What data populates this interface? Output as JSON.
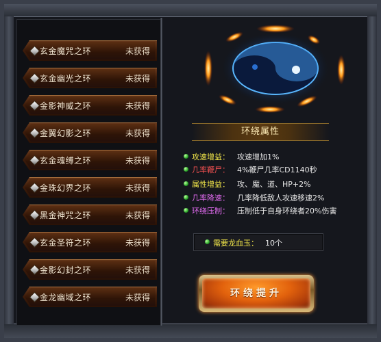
{
  "rings": [
    {
      "name": "玄金魔咒之环",
      "status": "未获得"
    },
    {
      "name": "玄金幽光之环",
      "status": "未获得"
    },
    {
      "name": "金影神威之环",
      "status": "未获得"
    },
    {
      "name": "金翼幻影之环",
      "status": "未获得"
    },
    {
      "name": "玄金魂缚之环",
      "status": "未获得"
    },
    {
      "name": "金珠幻界之环",
      "status": "未获得"
    },
    {
      "name": "黑金神咒之环",
      "status": "未获得"
    },
    {
      "name": "玄金圣符之环",
      "status": "未获得"
    },
    {
      "name": "金影幻封之环",
      "status": "未获得"
    },
    {
      "name": "金龙幽域之环",
      "status": "未获得"
    }
  ],
  "attributes": {
    "header": "环绕属性",
    "rows": [
      {
        "label": "攻速增益：",
        "value": "攻速增加1%",
        "color": "#f4e84a"
      },
      {
        "label": "几率鞭尸：",
        "value": "4%鞭尸几率CD1140秒",
        "color": "#f05050"
      },
      {
        "label": "属性增益：",
        "value": "攻、魔、道、HP+2%",
        "color": "#f4e84a"
      },
      {
        "label": "几率降速：",
        "value": "几率降低敌人攻速移速2%",
        "color": "#e36cf2"
      },
      {
        "label": "环绕压制：",
        "value": "压制低于自身环绕者20%伤害",
        "color": "#e36cf2"
      }
    ]
  },
  "requirement": {
    "label": "需要龙血玉：",
    "value": "10个"
  },
  "upgrade_button": {
    "label": "环绕提升"
  },
  "colors": {
    "accent_orange": "#e2620d",
    "bullet_green": "#2aa72a"
  }
}
